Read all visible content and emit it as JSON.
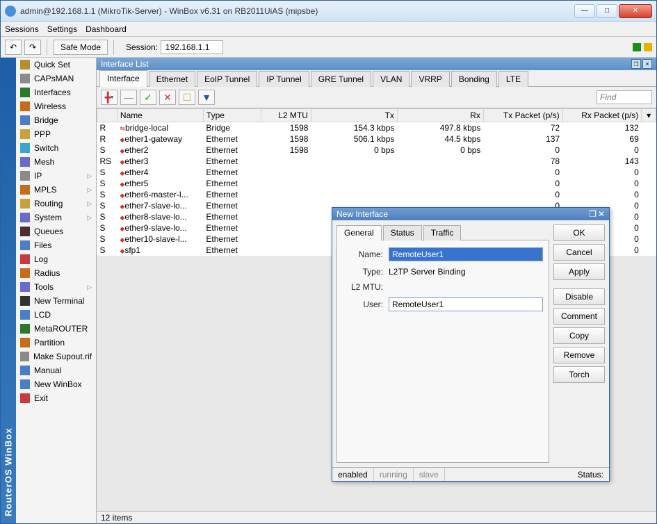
{
  "window": {
    "title": "admin@192.168.1.1 (MikroTik-Server) - WinBox v6.31 on RB2011UiAS (mipsbe)"
  },
  "menubar": [
    "Sessions",
    "Settings",
    "Dashboard"
  ],
  "toolbar": {
    "undo": "↶",
    "redo": "↷",
    "safe_mode": "Safe Mode",
    "session_label": "Session:",
    "session_value": "192.168.1.1"
  },
  "vstrip": "RouterOS WinBox",
  "sidebar": [
    {
      "label": "Quick Set",
      "sub": ""
    },
    {
      "label": "CAPsMAN",
      "sub": ""
    },
    {
      "label": "Interfaces",
      "sub": ""
    },
    {
      "label": "Wireless",
      "sub": ""
    },
    {
      "label": "Bridge",
      "sub": ""
    },
    {
      "label": "PPP",
      "sub": ""
    },
    {
      "label": "Switch",
      "sub": ""
    },
    {
      "label": "Mesh",
      "sub": ""
    },
    {
      "label": "IP",
      "sub": "▷"
    },
    {
      "label": "MPLS",
      "sub": "▷"
    },
    {
      "label": "Routing",
      "sub": "▷"
    },
    {
      "label": "System",
      "sub": "▷"
    },
    {
      "label": "Queues",
      "sub": ""
    },
    {
      "label": "Files",
      "sub": ""
    },
    {
      "label": "Log",
      "sub": ""
    },
    {
      "label": "Radius",
      "sub": ""
    },
    {
      "label": "Tools",
      "sub": "▷"
    },
    {
      "label": "New Terminal",
      "sub": ""
    },
    {
      "label": "LCD",
      "sub": ""
    },
    {
      "label": "MetaROUTER",
      "sub": ""
    },
    {
      "label": "Partition",
      "sub": ""
    },
    {
      "label": "Make Supout.rif",
      "sub": ""
    },
    {
      "label": "Manual",
      "sub": ""
    },
    {
      "label": "New WinBox",
      "sub": ""
    },
    {
      "label": "Exit",
      "sub": ""
    }
  ],
  "interface_list": {
    "title": "Interface List",
    "tabs": [
      "Interface",
      "Ethernet",
      "EoIP Tunnel",
      "IP Tunnel",
      "GRE Tunnel",
      "VLAN",
      "VRRP",
      "Bonding",
      "LTE"
    ],
    "active_tab": 0,
    "find_placeholder": "Find",
    "columns": [
      "",
      "Name",
      "Type",
      "L2 MTU",
      "Tx",
      "Rx",
      "Tx Packet (p/s)",
      "Rx Packet (p/s)"
    ],
    "rows": [
      {
        "f": "R",
        "name": "bridge-local",
        "type": "Bridge",
        "l2mtu": "1598",
        "tx": "154.3 kbps",
        "rx": "497.8 kbps",
        "txp": "72",
        "rxp": "132",
        "sym": "⇋"
      },
      {
        "f": "R",
        "name": "ether1-gateway",
        "type": "Ethernet",
        "l2mtu": "1598",
        "tx": "506.1 kbps",
        "rx": "44.5 kbps",
        "txp": "137",
        "rxp": "69",
        "sym": "◆"
      },
      {
        "f": "S",
        "name": "ether2",
        "type": "Ethernet",
        "l2mtu": "1598",
        "tx": "0 bps",
        "rx": "0 bps",
        "txp": "0",
        "rxp": "0",
        "sym": "◆"
      },
      {
        "f": "RS",
        "name": "ether3",
        "type": "Ethernet",
        "l2mtu": "",
        "tx": "",
        "rx": "",
        "txp": "78",
        "rxp": "143",
        "sym": "◆"
      },
      {
        "f": "S",
        "name": "ether4",
        "type": "Ethernet",
        "l2mtu": "",
        "tx": "",
        "rx": "",
        "txp": "0",
        "rxp": "0",
        "sym": "◆"
      },
      {
        "f": "S",
        "name": "ether5",
        "type": "Ethernet",
        "l2mtu": "",
        "tx": "",
        "rx": "",
        "txp": "0",
        "rxp": "0",
        "sym": "◆"
      },
      {
        "f": "S",
        "name": "ether6-master-l...",
        "type": "Ethernet",
        "l2mtu": "",
        "tx": "",
        "rx": "",
        "txp": "0",
        "rxp": "0",
        "sym": "◆"
      },
      {
        "f": "S",
        "name": "ether7-slave-lo...",
        "type": "Ethernet",
        "l2mtu": "",
        "tx": "",
        "rx": "",
        "txp": "0",
        "rxp": "0",
        "sym": "◆"
      },
      {
        "f": "S",
        "name": "ether8-slave-lo...",
        "type": "Ethernet",
        "l2mtu": "",
        "tx": "",
        "rx": "",
        "txp": "0",
        "rxp": "0",
        "sym": "◆"
      },
      {
        "f": "S",
        "name": "ether9-slave-lo...",
        "type": "Ethernet",
        "l2mtu": "",
        "tx": "",
        "rx": "",
        "txp": "0",
        "rxp": "0",
        "sym": "◆"
      },
      {
        "f": "S",
        "name": "ether10-slave-l...",
        "type": "Ethernet",
        "l2mtu": "",
        "tx": "",
        "rx": "",
        "txp": "0",
        "rxp": "0",
        "sym": "◆"
      },
      {
        "f": "S",
        "name": "sfp1",
        "type": "Ethernet",
        "l2mtu": "",
        "tx": "",
        "rx": "",
        "txp": "0",
        "rxp": "0",
        "sym": "◆"
      }
    ],
    "status": "12 items"
  },
  "dialog": {
    "title": "New Interface",
    "tabs": [
      "General",
      "Status",
      "Traffic"
    ],
    "active_tab": 0,
    "fields": {
      "name_label": "Name:",
      "name_value": "RemoteUser1",
      "type_label": "Type:",
      "type_value": "L2TP Server Binding",
      "l2mtu_label": "L2 MTU:",
      "l2mtu_value": "",
      "user_label": "User:",
      "user_value": "RemoteUser1"
    },
    "buttons": [
      "OK",
      "Cancel",
      "Apply",
      "Disable",
      "Comment",
      "Copy",
      "Remove",
      "Torch"
    ],
    "status_cells": [
      "enabled",
      "running",
      "slave"
    ],
    "status_label": "Status:"
  }
}
